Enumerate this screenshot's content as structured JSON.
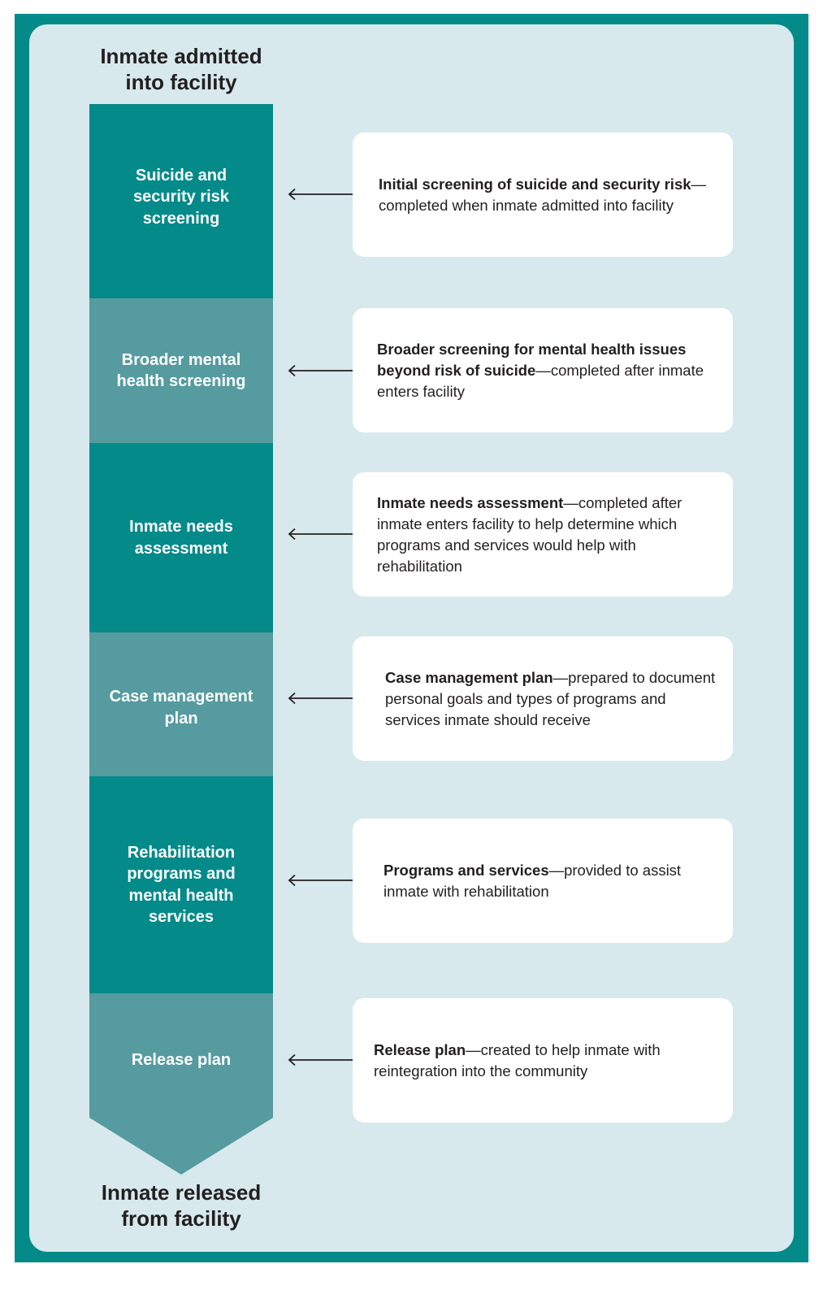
{
  "diagram": {
    "start_label": "Inmate admitted into facility",
    "end_label": "Inmate released from facility",
    "colors": {
      "frame": "#058a8a",
      "panel": "#d7e9ec",
      "step_dark": "#058a8a",
      "step_light": "#559b9f",
      "card": "#ffffff",
      "text": "#231f20",
      "arrow": "#231f20"
    },
    "steps": [
      {
        "label": "Suicide and security risk screening",
        "shade": "dark",
        "description_bold": "Initial screening of suicide and security risk",
        "description_rest": "—completed when inmate admitted into facility"
      },
      {
        "label": "Broader mental health screening",
        "shade": "light",
        "description_bold": "Broader screening for mental health issues beyond risk of suicide",
        "description_rest": "—completed after inmate enters facility"
      },
      {
        "label": "Inmate needs assessment",
        "shade": "dark",
        "description_bold": "Inmate needs assessment",
        "description_rest": "—completed after inmate enters facility to help determine which programs and services would help with rehabilitation"
      },
      {
        "label": "Case management plan",
        "shade": "light",
        "description_bold": "Case management plan",
        "description_rest": "—prepared to document personal goals and types of programs and services inmate should receive"
      },
      {
        "label": "Rehabilitation programs and mental health services",
        "shade": "dark",
        "description_bold": "Programs and services",
        "description_rest": "—provided to assist inmate with rehabilitation"
      },
      {
        "label": "Release plan",
        "shade": "light",
        "description_bold": "Release plan",
        "description_rest": "—created to help inmate with reintegration into the community"
      }
    ]
  }
}
